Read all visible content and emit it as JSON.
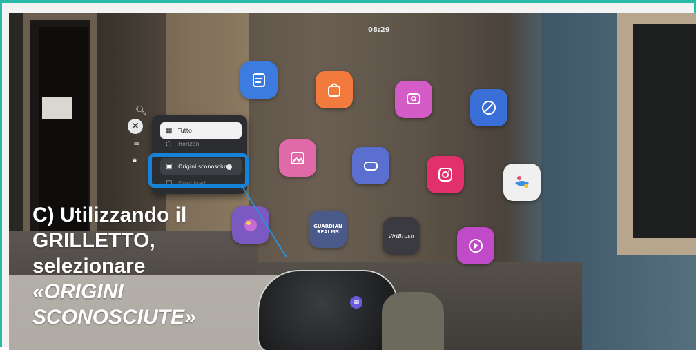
{
  "status_bar": {
    "time": "08:29"
  },
  "apps": [
    {
      "name": "app-notes-icon",
      "color": "#3c7be0"
    },
    {
      "name": "app-store-icon",
      "color": "#f17a3c"
    },
    {
      "name": "app-feedback-icon",
      "color": "#d35cc6"
    },
    {
      "name": "app-explore-icon",
      "color": "#3a6fd8"
    },
    {
      "name": "app-gallery-icon",
      "color": "#e06aa8"
    },
    {
      "name": "app-vr-icon",
      "color": "#5a6fd0"
    },
    {
      "name": "app-instagram-icon",
      "color": "#e1306c"
    },
    {
      "name": "app-horizon-icon",
      "color": "#f0f0f0"
    },
    {
      "name": "app-game-icon",
      "color": "#7a5ac0"
    },
    {
      "name": "app-guardian-realms-icon",
      "color": "#4a5a8a",
      "label": "GUARDIAN REALMS"
    },
    {
      "name": "app-vrbrush-icon",
      "color": "#3a3a40",
      "label": "VirtBrush"
    },
    {
      "name": "app-media-icon",
      "color": "#c04ac8"
    }
  ],
  "library_menu": {
    "items": [
      {
        "label": "Tutto",
        "icon": "grid-icon"
      },
      {
        "label": "Horizon",
        "icon": "horizon-icon"
      },
      {
        "label": "Origini sconosciute",
        "icon": "folder-icon"
      },
      {
        "label": "Download",
        "icon": "download-icon"
      }
    ]
  },
  "caption": {
    "line1": "C) Utilizzando il",
    "line2": "GRILLETTO,",
    "line3": "selezionare",
    "line4": "«ORIGINI",
    "line5": "SCONOSCIUTE»"
  },
  "colors": {
    "frame": "#2bb9a8",
    "highlight": "#1683d8",
    "panel_bg": "#2b2d30"
  }
}
